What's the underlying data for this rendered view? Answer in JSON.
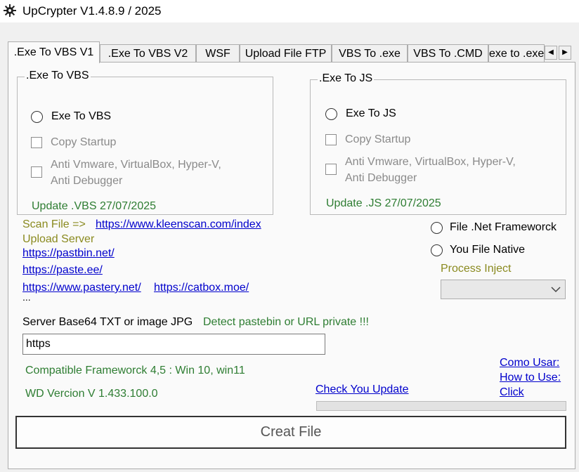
{
  "window": {
    "title": "UpCrypter V1.4.8.9 / 2025",
    "icon": "gear-icon"
  },
  "tabs": [
    {
      "label": ".Exe To VBS V1",
      "active": true
    },
    {
      "label": ".Exe To VBS V2",
      "active": false
    },
    {
      "label": "WSF",
      "active": false
    },
    {
      "label": "Upload File FTP",
      "active": false
    },
    {
      "label": "VBS To .exe",
      "active": false
    },
    {
      "label": "VBS To .CMD",
      "active": false
    },
    {
      "label": "exe to .exe",
      "active": false
    }
  ],
  "tab_scroll": {
    "left": "◀",
    "right": "▶"
  },
  "vbs_group": {
    "legend": ".Exe To VBS",
    "radio_label": "Exe To VBS",
    "copy_startup": "Copy Startup",
    "anti_line1": "Anti Vmware, VirtualBox, Hyper-V,",
    "anti_line2": "Anti Debugger",
    "update": "Update .VBS 27/07/2025"
  },
  "js_group": {
    "legend": ".Exe To JS",
    "radio_label": "Exe To JS",
    "copy_startup": "Copy Startup",
    "anti_line1": "Anti Vmware, VirtualBox, Hyper-V,",
    "anti_line2": "Anti Debugger",
    "update": "Update .JS 27/07/2025"
  },
  "scan": {
    "label": "Scan File =>",
    "url": "https://www.kleenscan.com/index"
  },
  "upload": {
    "label": "Upload Server",
    "links": [
      "https://pastbin.net/",
      "https://paste.ee/",
      "https://www.pastery.net/",
      "https://catbox.moe/"
    ],
    "ellipsis": "..."
  },
  "framework": {
    "net_label": "File .Net Frameworck",
    "native_label": "You File Native",
    "process_inject_label": "Process Inject",
    "process_inject_value": ""
  },
  "server": {
    "label": "Server Base64 TXT or image JPG",
    "detect": "Detect pastebin or URL private !!!",
    "value": "https"
  },
  "info": {
    "compatible": "Compatible Frameworck 4,5 :  Win 10, win11",
    "version": "WD Vercion V 1.433.100.0"
  },
  "help_links": {
    "como": "Como Usar:",
    "how": "How to Use:",
    "click": "Click"
  },
  "check_update": "Check You Update",
  "update_progress": 0,
  "creat_button": "Creat File"
}
